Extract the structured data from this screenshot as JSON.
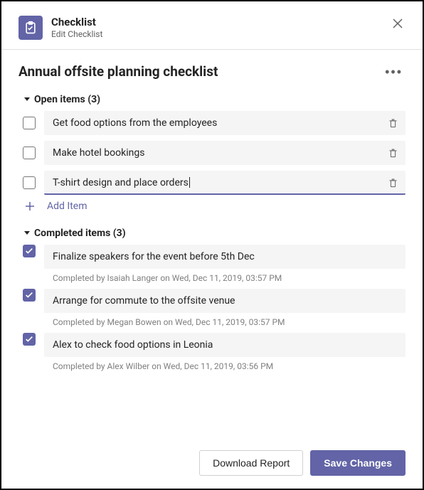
{
  "header": {
    "app_title": "Checklist",
    "app_subtitle": "Edit Checklist"
  },
  "title": "Annual offsite planning checklist",
  "sections": {
    "open": {
      "label": "Open items (3)",
      "items": [
        {
          "text": "Get food options from the employees",
          "focused": false
        },
        {
          "text": "Make hotel bookings",
          "focused": false
        },
        {
          "text": "T-shirt design and place orders",
          "focused": true
        }
      ],
      "add_label": "Add Item"
    },
    "completed": {
      "label": "Completed items (3)",
      "items": [
        {
          "text": "Finalize speakers for the event before 5th Dec",
          "meta": "Completed by Isaiah Langer on Wed, Dec 11, 2019, 03:57 PM"
        },
        {
          "text": "Arrange for commute to the offsite venue",
          "meta": "Completed by Megan Bowen on Wed, Dec 11, 2019, 03:57 PM"
        },
        {
          "text": "Alex to check food options in Leonia",
          "meta": "Completed by Alex Wilber on Wed, Dec 11, 2019, 03:56 PM"
        }
      ]
    }
  },
  "footer": {
    "download_label": "Download Report",
    "save_label": "Save Changes"
  }
}
